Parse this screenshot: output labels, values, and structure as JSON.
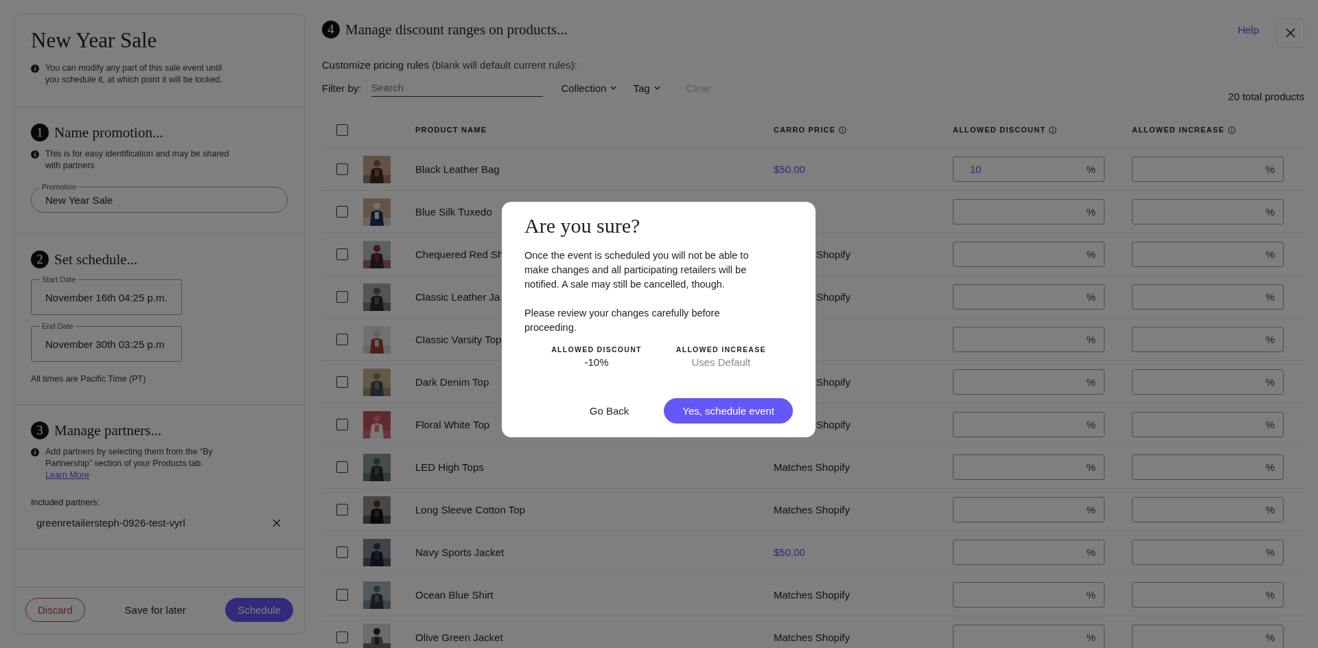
{
  "sidebar": {
    "title": "New Year Sale",
    "notice": "You can modify any part of this sale event until you schedule it, at which point it will be locked.",
    "sections": [
      {
        "kind": "name",
        "number": "1",
        "heading": "Name promotion...",
        "note": "This is for easy identification and may be shared with partners",
        "field": {
          "label": "Promotion",
          "value": "New Year Sale"
        }
      },
      {
        "kind": "schedule",
        "number": "2",
        "heading": "Set schedule...",
        "fields": [
          {
            "label": "Start Date",
            "value": "November 16th 04:25 p.m."
          },
          {
            "label": "End Date",
            "value": "November 30th 03:25 p.m"
          }
        ],
        "footnote": "All times are Pacific Time (PT)"
      },
      {
        "kind": "partners",
        "number": "3",
        "heading": "Manage partners...",
        "note": "Add partners by selecting them from the “By Partnership” section of your Products tab.",
        "link": "Learn More",
        "list_label": "Included partners:",
        "partners": [
          "greenretailersteph-0926-test-vyrl"
        ]
      }
    ],
    "buttons": [
      {
        "label": "Discard",
        "kind": "danger"
      },
      {
        "label": "Save for later",
        "kind": "plain"
      },
      {
        "label": "Schedule",
        "kind": "primary"
      }
    ]
  },
  "main": {
    "number": "4",
    "heading": "Manage discount ranges on products...",
    "help": "Help",
    "subtitle": "Customize pricing rules",
    "subtitle_hint": "(blank will default current rules):",
    "filter_label": "Filter by:",
    "search_placeholder": "Search",
    "filters": [
      "Collection",
      "Tag"
    ],
    "clear": {
      "label": "Clear",
      "disabled": true
    },
    "total": "20 total products"
  },
  "table": {
    "all_checked": false,
    "columns": [
      {
        "label": "PRODUCT NAME",
        "info": false
      },
      {
        "label": "CARRO PRICE",
        "info": true
      },
      {
        "label": "ALLOWED DISCOUNT",
        "info": true
      },
      {
        "label": "ALLOWED INCREASE",
        "info": true
      }
    ],
    "rows": [
      {
        "name": "Black Leather Bag",
        "checked": false,
        "price": {
          "text": "$50.00",
          "kind": "custom"
        },
        "discount": {
          "value": "10",
          "unit": "%"
        },
        "increase": {
          "unit": "%"
        }
      },
      {
        "name": "Blue Silk Tuxedo",
        "checked": false,
        "discount": {
          "unit": "%"
        },
        "increase": {
          "unit": "%"
        }
      },
      {
        "name": "Chequered Red Sh",
        "checked": false,
        "price": {
          "text": "Shopify",
          "kind": "partial"
        },
        "discount": {
          "unit": "%"
        },
        "increase": {
          "unit": "%"
        }
      },
      {
        "name": "Classic Leather Ja",
        "checked": false,
        "price": {
          "text": "Shopify",
          "kind": "partial"
        },
        "discount": {
          "unit": "%"
        },
        "increase": {
          "unit": "%"
        }
      },
      {
        "name": "Classic Varsity Top",
        "checked": false,
        "discount": {
          "unit": "%"
        },
        "increase": {
          "unit": "%"
        }
      },
      {
        "name": "Dark Denim Top",
        "checked": false,
        "price": {
          "text": "Shopify",
          "kind": "partial"
        },
        "discount": {
          "unit": "%"
        },
        "increase": {
          "unit": "%"
        }
      },
      {
        "name": "Floral White Top",
        "checked": false,
        "price": {
          "text": "Shopify",
          "kind": "partial"
        },
        "discount": {
          "unit": "%"
        },
        "increase": {
          "unit": "%"
        }
      },
      {
        "name": "LED High Tops",
        "checked": false,
        "price": {
          "text": "Matches Shopify",
          "kind": "default"
        },
        "discount": {
          "unit": "%"
        },
        "increase": {
          "unit": "%"
        }
      },
      {
        "name": "Long Sleeve Cotton Top",
        "checked": false,
        "price": {
          "text": "Matches Shopify",
          "kind": "default"
        },
        "discount": {
          "unit": "%"
        },
        "increase": {
          "unit": "%"
        }
      },
      {
        "name": "Navy Sports Jacket",
        "checked": false,
        "price": {
          "text": "$50.00",
          "kind": "custom"
        },
        "discount": {
          "unit": "%"
        },
        "increase": {
          "unit": "%"
        }
      },
      {
        "name": "Ocean Blue Shirt",
        "checked": false,
        "price": {
          "text": "Matches Shopify",
          "kind": "default"
        },
        "discount": {
          "unit": "%"
        },
        "increase": {
          "unit": "%"
        }
      },
      {
        "name": "Olive Green Jacket",
        "checked": false,
        "price": {
          "text": "Matches Shopify",
          "kind": "default"
        },
        "discount": {
          "unit": "%"
        },
        "increase": {
          "unit": "%"
        }
      }
    ]
  },
  "dialog": {
    "title": "Are you sure?",
    "paragraphs": [
      "Once the event is scheduled you will not be able to make changes and all participating retailers will be notified. A sale may still be cancelled, though.",
      "Please review your changes carefully before proceeding."
    ],
    "stats": [
      {
        "label": "ALLOWED DISCOUNT",
        "value": "-10%",
        "muted": false
      },
      {
        "label": "ALLOWED INCREASE",
        "value": "Uses Default",
        "muted": true
      }
    ],
    "buttons": [
      {
        "label": "Go Back",
        "kind": "plain"
      },
      {
        "label": "Yes, schedule event",
        "kind": "primary"
      }
    ]
  }
}
